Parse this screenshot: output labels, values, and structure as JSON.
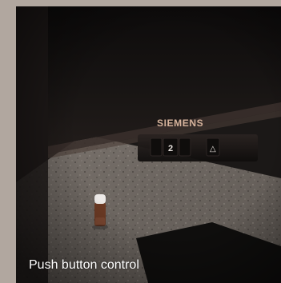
{
  "brand": {
    "logo_text": "SIEMENS",
    "logo_color": "#d6b39c"
  },
  "control_panel": {
    "level_value": "2",
    "light_symbol": "△"
  },
  "caption": {
    "text": "Push button control"
  },
  "colors": {
    "frame": "#b1a79f",
    "hood_dark": "#151312",
    "hood_edge": "#3a2f2b",
    "countertop": "#6f6862",
    "backsplash": "#8d857f"
  }
}
